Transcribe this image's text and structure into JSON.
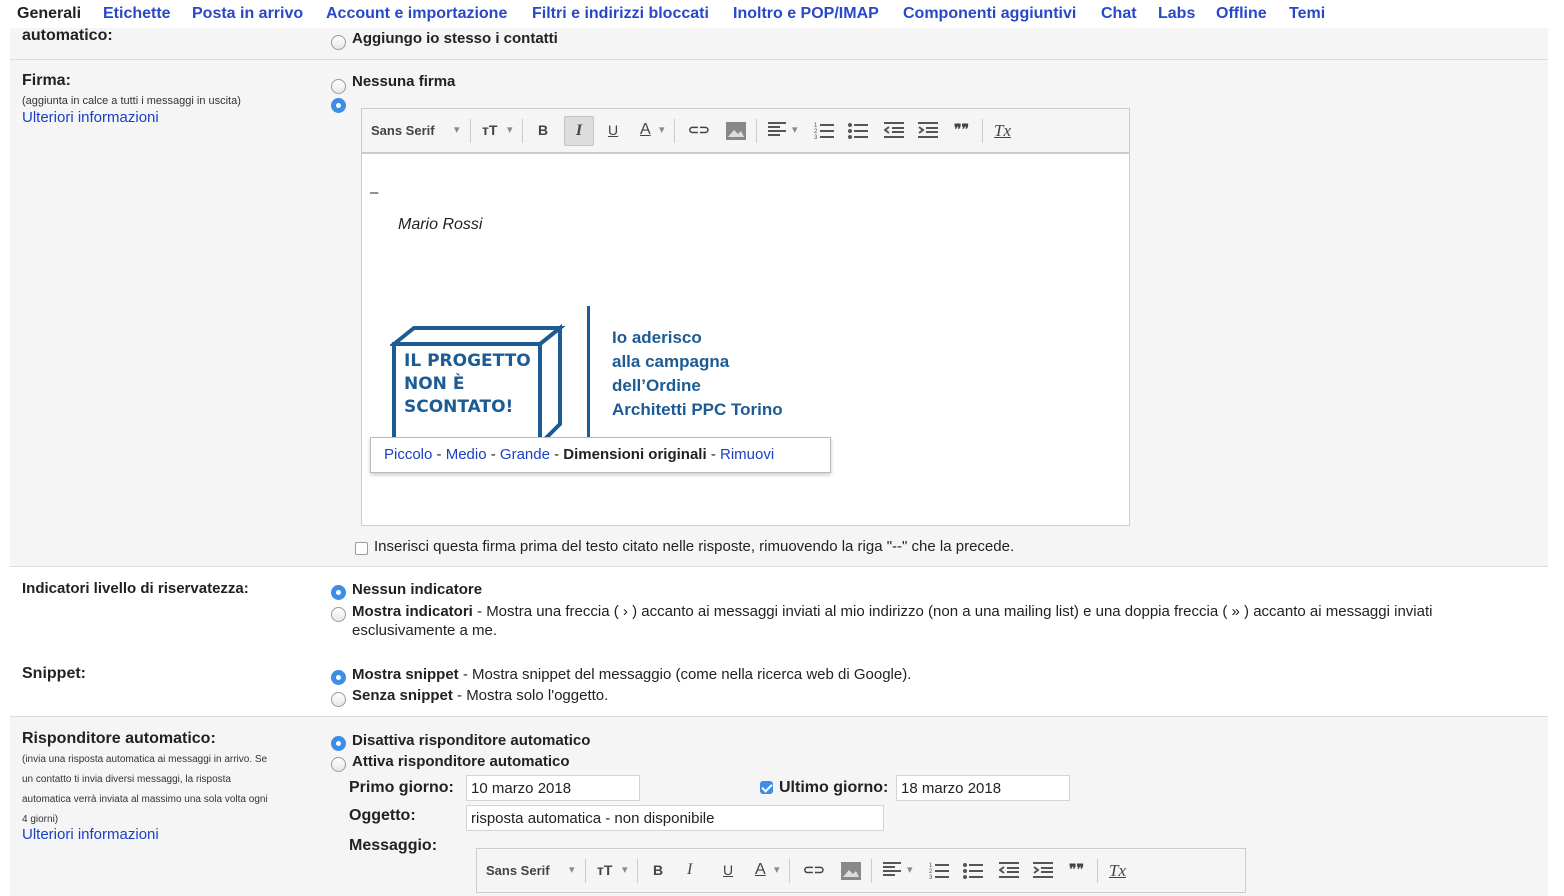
{
  "tabs": [
    {
      "label": "Generali"
    },
    {
      "label": "Etichette"
    },
    {
      "label": "Posta in arrivo"
    },
    {
      "label": "Account e importazione"
    },
    {
      "label": "Filtri e indirizzi bloccati"
    },
    {
      "label": "Inoltro e POP/IMAP"
    },
    {
      "label": "Componenti aggiuntivi"
    },
    {
      "label": "Chat"
    },
    {
      "label": "Labs"
    },
    {
      "label": "Offline"
    },
    {
      "label": "Temi"
    }
  ],
  "autocontacts": {
    "label": "automatico:",
    "option": "Aggiungo io stesso i contatti"
  },
  "signature": {
    "label": "Firma:",
    "sub": "(aggiunta in calce a tutti i messaggi in uscita)",
    "more": "Ulteriori informazioni",
    "no_signature": "Nessuna firma",
    "toolbar": {
      "font": "Sans Serif",
      "size": "тT",
      "bold": "B",
      "italic": "I",
      "underline": "U",
      "color": "A",
      "link": "⊂⊃",
      "quote": "❞❞",
      "clear": "Tx"
    },
    "dash": "–",
    "name": "Mario Rossi",
    "logo": {
      "box_text": [
        "IL PROGETTO",
        "NON È",
        "SCONTATO!"
      ],
      "side_text": [
        "Io aderisco",
        "alla campagna",
        "dell’Ordine",
        "Architetti PPC Torino"
      ],
      "color": "#1d5b94"
    },
    "resize": {
      "small": "Piccolo",
      "medium": "Medio",
      "large": "Grande",
      "original": "Dimensioni originali",
      "remove": "Rimuovi",
      "sep": " - "
    },
    "insert_before": "Inserisci questa firma prima del testo citato nelle risposte, rimuovendo la riga \"--\" che la precede."
  },
  "privacy": {
    "label": "Indicatori livello di riservatezza:",
    "none": "Nessun indicatore",
    "show_bold": "Mostra indicatori",
    "show_desc": " - Mostra una freccia ( › ) accanto ai messaggi inviati al mio indirizzo (non a una mailing list) e una doppia freccia ( » ) accanto ai messaggi inviati",
    "show_desc2": "esclusivamente a me."
  },
  "snippet": {
    "label": "Snippet:",
    "show_bold": "Mostra snippet",
    "show_desc": " - Mostra snippet del messaggio (come nella ricerca web di Google).",
    "hide_bold": "Senza snippet",
    "hide_desc": " - Mostra solo l'oggetto."
  },
  "autoreply": {
    "label": "Risponditore automatico:",
    "sub": [
      "(invia una risposta automatica ai messaggi in arrivo. Se",
      "un contatto ti invia diversi messaggi, la risposta",
      "automatica verrà inviata al massimo una sola volta ogni",
      "4 giorni)"
    ],
    "more": "Ulteriori informazioni",
    "off": "Disattiva risponditore automatico",
    "on": "Attiva risponditore automatico",
    "first_day_label": "Primo giorno:",
    "first_day": "10 marzo 2018",
    "last_day_label": "Ultimo giorno:",
    "last_day": "18 marzo 2018",
    "subject_label": "Oggetto:",
    "subject": "risposta automatica - non disponibile",
    "message_label": "Messaggio:"
  },
  "colors": {
    "link": "#1a3fc4",
    "accent": "#3b8de8",
    "band": "#f5f5f5"
  }
}
